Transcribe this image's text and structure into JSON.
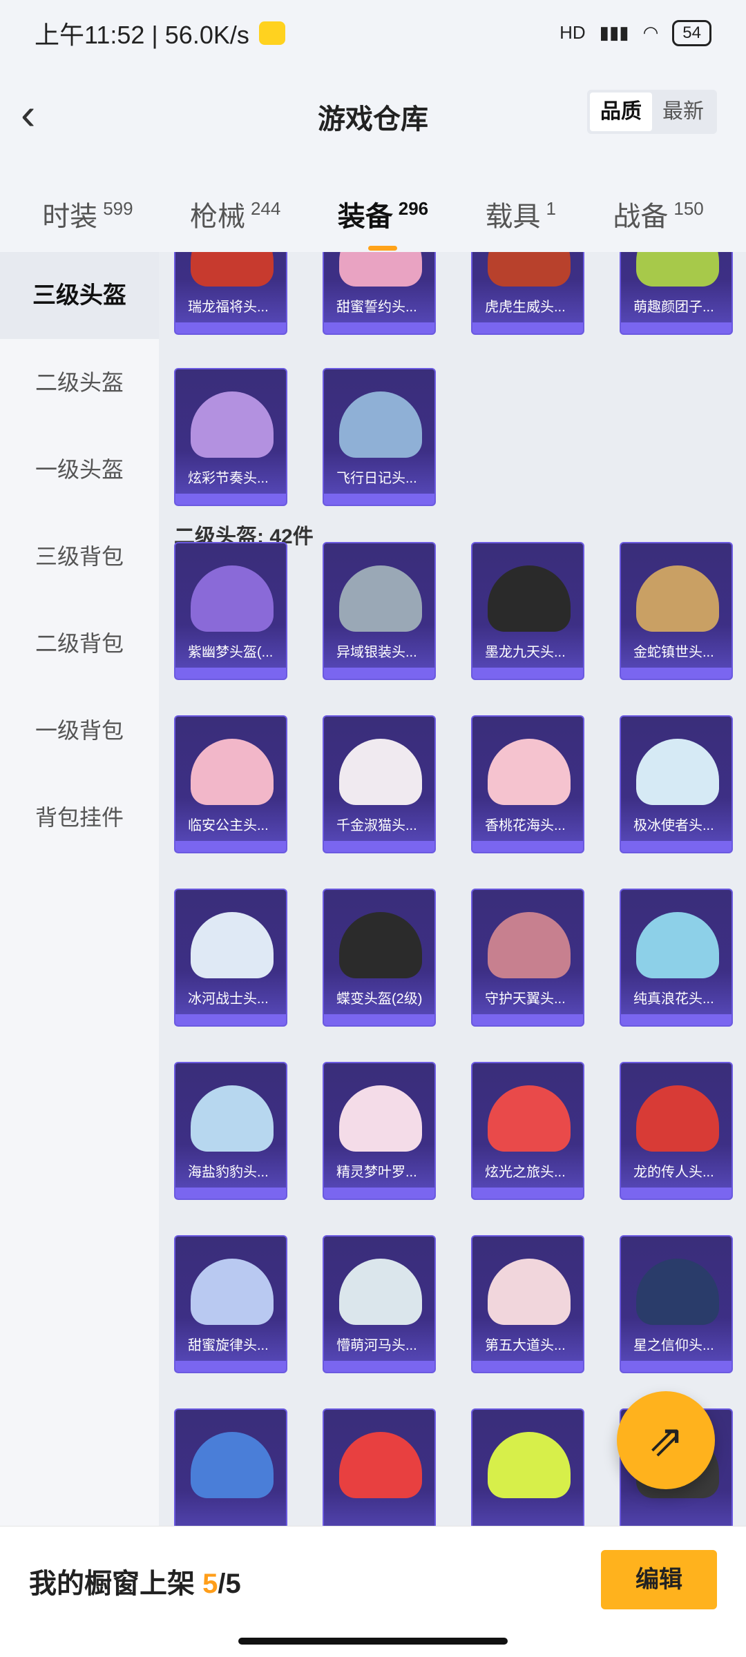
{
  "status_bar": {
    "time": "上午11:52 | 56.0K/s",
    "battery": "54",
    "network": "HD"
  },
  "header": {
    "title": "游戏仓库",
    "sort_options": [
      "品质",
      "最新"
    ]
  },
  "tabs": [
    {
      "label": "时装",
      "count": "599"
    },
    {
      "label": "枪械",
      "count": "244"
    },
    {
      "label": "装备",
      "count": "296"
    },
    {
      "label": "载具",
      "count": "1"
    },
    {
      "label": "战备",
      "count": "150"
    }
  ],
  "sidebar": {
    "items": [
      "三级头盔",
      "二级头盔",
      "一级头盔",
      "三级背包",
      "二级背包",
      "一级背包",
      "背包挂件"
    ]
  },
  "grid": {
    "row_top": [
      "瑞龙福将头...",
      "甜蜜誓约头...",
      "虎虎生威头...",
      "萌趣颜团子..."
    ],
    "row_two": [
      "炫彩节奏头...",
      "飞行日记头..."
    ],
    "section_title": "二级头盔: 42件",
    "level2_items": [
      "紫幽梦头盔(...",
      "异域银装头...",
      "墨龙九天头...",
      "金蛇镇世头...",
      "临安公主头...",
      "千金淑猫头...",
      "香桃花海头...",
      "极冰使者头...",
      "冰河战士头...",
      "蝶变头盔(2级)",
      "守护天翼头...",
      "纯真浪花头...",
      "海盐豹豹头...",
      "精灵梦叶罗...",
      "炫光之旅头...",
      "龙的传人头...",
      "甜蜜旋律头...",
      "懵萌河马头...",
      "第五大道头...",
      "星之信仰头...",
      "",
      "",
      "",
      ""
    ]
  },
  "bottom_bar": {
    "label": "我的橱窗上架",
    "current": "5",
    "total": "/5",
    "edit": "编辑"
  },
  "colors": {
    "accent": "#ffb21d",
    "card_bg": "#3d2f85",
    "card_border": "#6b5ae0"
  }
}
